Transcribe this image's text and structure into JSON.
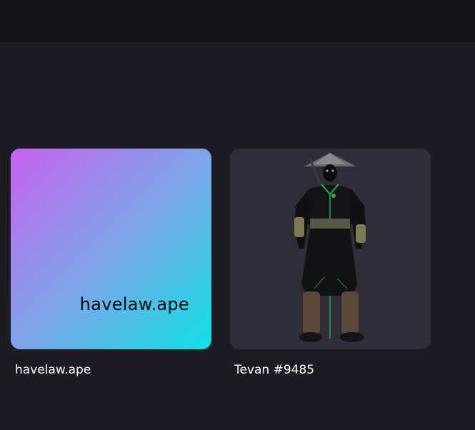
{
  "cards": [
    {
      "title": "havelaw.ape",
      "thumbnail_text": "havelaw.ape",
      "thumbnail_colors": [
        "#c762ef",
        "#7fa4e9",
        "#0fe0e8"
      ]
    },
    {
      "title": "Tevan #9485",
      "thumbnail_icon": "warrior-figure-icon",
      "thumbnail_bg": "#2f2e38"
    }
  ],
  "colors": {
    "page_bg": "#1d1c23",
    "topbar_bg": "#141416",
    "text": "#ffffff"
  }
}
